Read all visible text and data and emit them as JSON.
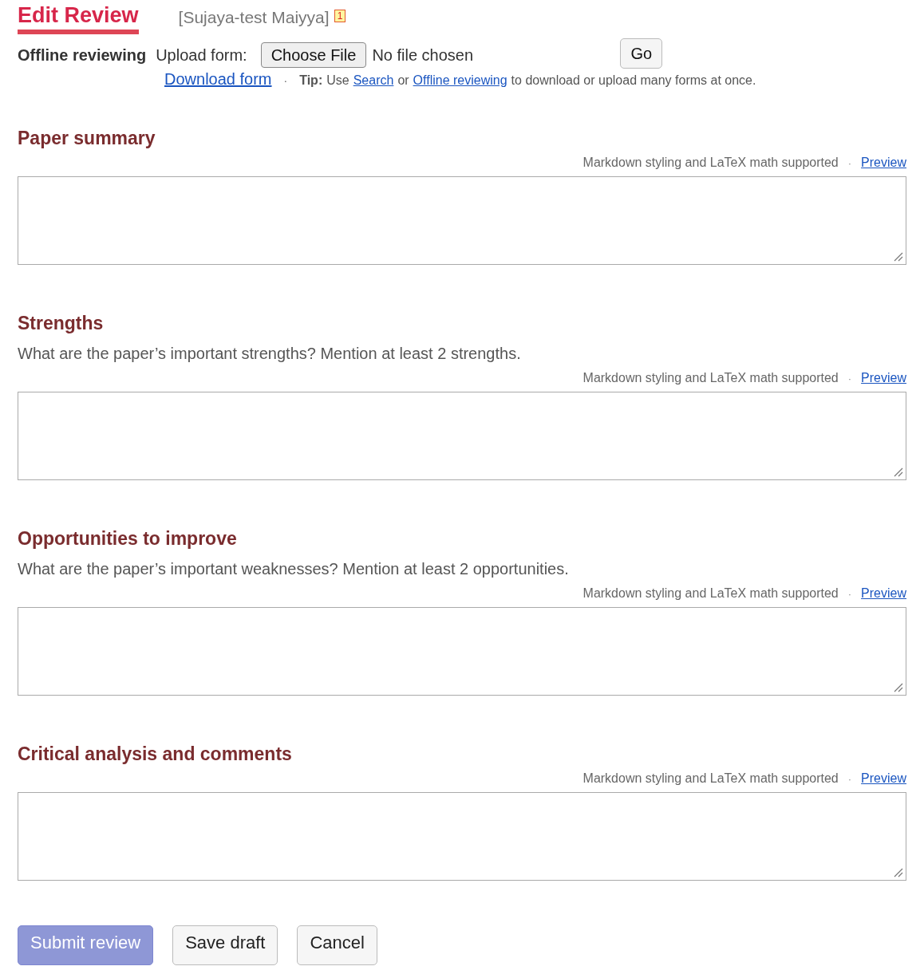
{
  "header": {
    "title": "Edit Review",
    "subtitle": "[Sujaya-test Maiyya]",
    "badge": "1"
  },
  "offline": {
    "label": "Offline reviewing",
    "upload_label": "Upload form:",
    "file_button": "Choose File",
    "file_status": "No file chosen",
    "go_button": "Go",
    "download_link": "Download form",
    "separator": "·",
    "tip_label": "Tip:",
    "tip_parts": [
      {
        "kind": "text",
        "text": "Use"
      },
      {
        "kind": "link",
        "text": "Search"
      },
      {
        "kind": "text",
        "text": "or"
      },
      {
        "kind": "link",
        "text": "Offline reviewing"
      },
      {
        "kind": "text",
        "text": "to download or upload many forms at once."
      }
    ]
  },
  "sections": [
    {
      "heading": "Paper summary",
      "note": "Markdown styling and LaTeX math supported",
      "separator": "·",
      "preview": "Preview"
    },
    {
      "heading": "Strengths",
      "description": "What are the paper’s important strengths? Mention at least 2 strengths.",
      "note": "Markdown styling and LaTeX math supported",
      "separator": "·",
      "preview": "Preview"
    },
    {
      "heading": "Opportunities to improve",
      "description": "What are the paper’s important weaknesses? Mention at least 2 opportunities.",
      "note": "Markdown styling and LaTeX math supported",
      "separator": "·",
      "preview": "Preview"
    },
    {
      "heading": "Critical analysis and comments",
      "note": "Markdown styling and LaTeX math supported",
      "separator": "·",
      "preview": "Preview"
    }
  ],
  "buttons": [
    {
      "label": "Submit review",
      "kind": "primary"
    },
    {
      "label": "Save draft",
      "kind": "plain"
    },
    {
      "label": "Cancel",
      "kind": "plain"
    }
  ]
}
